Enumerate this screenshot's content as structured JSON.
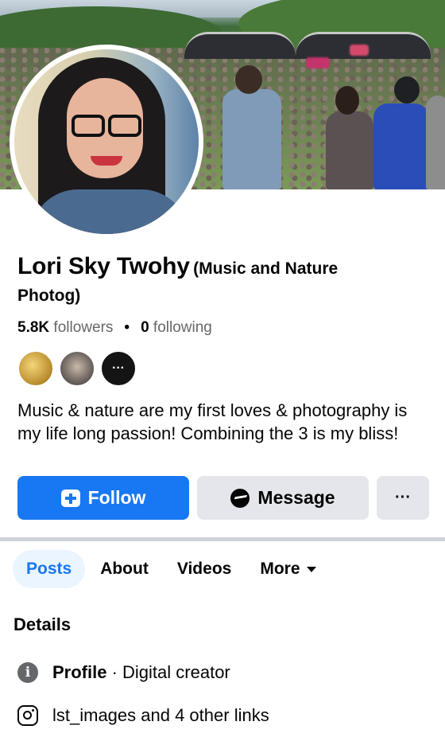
{
  "profile": {
    "name": "Lori Sky Twohy",
    "subtitle_line1": "(Music and Nature",
    "subtitle_line2": "Photog)",
    "followers_count": "5.8K",
    "followers_label": "followers",
    "following_count": "0",
    "following_label": "following",
    "bio": "Music & nature are my first loves & photography is my life long passion! Combining the 3 is my bliss!"
  },
  "mutuals": {
    "more_label": "···"
  },
  "actions": {
    "follow_label": "Follow",
    "message_label": "Message",
    "more_label": "···"
  },
  "tabs": [
    {
      "label": "Posts",
      "active": true
    },
    {
      "label": "About",
      "active": false
    },
    {
      "label": "Videos",
      "active": false
    },
    {
      "label": "More",
      "active": false
    }
  ],
  "details": {
    "title": "Details",
    "profile_label": "Profile",
    "profile_value": "· Digital creator",
    "links_text": "lst_images and 4 other links"
  },
  "colors": {
    "accent": "#1877f2",
    "secondary_button": "#e4e6eb",
    "active_tab_bg": "#ebf5ff"
  }
}
